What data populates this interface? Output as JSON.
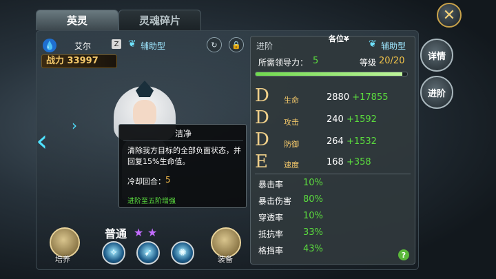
{
  "tabs": [
    {
      "label": "英灵",
      "active": true
    },
    {
      "label": "灵魂碎片",
      "active": false
    }
  ],
  "close_label": "✕",
  "hero": {
    "element_icon": "water-drop-icon",
    "name": "艾尔",
    "badge": "Z",
    "type": "辅助型",
    "power_label": "战力",
    "power_value": "33997",
    "rarity": "普通",
    "stars": 2
  },
  "tooltip": {
    "title": "洁净",
    "description": "清除我方目标的全部负面状态，并回复15%生命值。",
    "cooldown_label": "冷却回合：",
    "cooldown_value": "5",
    "upgrade_note": "进阶至五阶增强"
  },
  "left_buttons": {
    "cultivate": "培养",
    "equip": "装备"
  },
  "panel": {
    "header_left": "进阶",
    "header_center": "各位¥",
    "header_type": "辅助型",
    "leadership_label": "所需领导力：",
    "leadership_value": "5",
    "level_label": "等级",
    "level_value": "20/20",
    "xp_fraction": 0.97,
    "attributes": [
      {
        "grade": "D",
        "label": "生命",
        "base": "2880",
        "bonus": "+17855"
      },
      {
        "grade": "D",
        "label": "攻击",
        "base": "240",
        "bonus": "+1592"
      },
      {
        "grade": "D",
        "label": "防御",
        "base": "264",
        "bonus": "+1532"
      },
      {
        "grade": "E",
        "label": "速度",
        "base": "168",
        "bonus": "+358"
      }
    ],
    "secondary": [
      {
        "label": "暴击率",
        "value": "10%"
      },
      {
        "label": "暴击伤害",
        "value": "80%"
      },
      {
        "label": "穿透率",
        "value": "10%"
      },
      {
        "label": "抵抗率",
        "value": "33%"
      },
      {
        "label": "格挡率",
        "value": "43%"
      }
    ],
    "help": "?"
  },
  "right_buttons": {
    "details": "详情",
    "advance": "进阶"
  }
}
